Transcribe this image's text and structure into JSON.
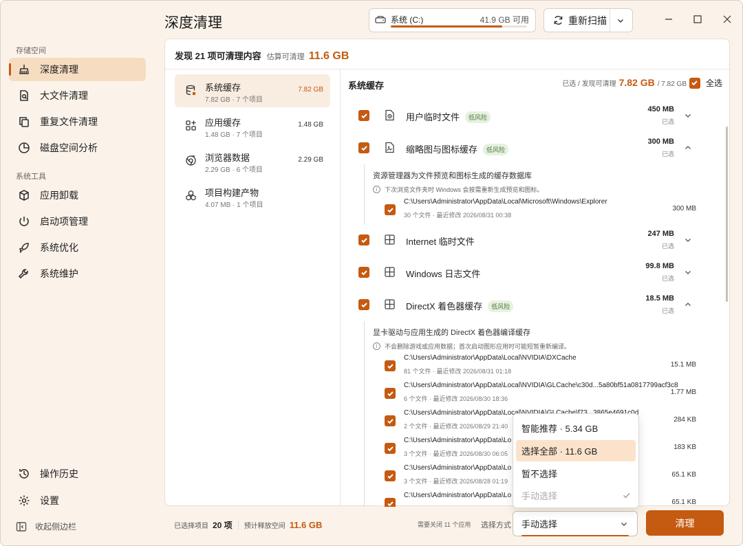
{
  "window": {
    "title": "深度清理"
  },
  "sidebar": {
    "section1": "存储空间",
    "section2": "系统工具",
    "items": [
      {
        "label": "深度清理",
        "icon": "broom-icon"
      },
      {
        "label": "大文件清理",
        "icon": "file-search-icon"
      },
      {
        "label": "重复文件清理",
        "icon": "copy-icon"
      },
      {
        "label": "磁盘空间分析",
        "icon": "pie-chart-icon"
      },
      {
        "label": "应用卸载",
        "icon": "package-remove-icon"
      },
      {
        "label": "启动项管理",
        "icon": "power-icon"
      },
      {
        "label": "系统优化",
        "icon": "rocket-icon"
      },
      {
        "label": "系统维护",
        "icon": "wrench-icon"
      },
      {
        "label": "操作历史",
        "icon": "history-icon"
      },
      {
        "label": "设置",
        "icon": "gear-icon"
      }
    ],
    "collapse": "收起侧边栏"
  },
  "disk": {
    "name": "系统 (C:)",
    "free": "41.9 GB 可用",
    "used_fraction": 0.82
  },
  "toolbar": {
    "rescan": "重新扫描"
  },
  "summary": {
    "prefix": "发现 21 项可清理内容",
    "est_label": "估算可清理",
    "est_value": "11.6 GB"
  },
  "categories": [
    {
      "name": "系统缓存",
      "meta": "7.82 GB · 7 个项目",
      "size": "7.82 GB"
    },
    {
      "name": "应用缓存",
      "meta": "1.48 GB · 7 个项目",
      "size": "1.48 GB"
    },
    {
      "name": "浏览器数据",
      "meta": "2.29 GB · 6 个项目",
      "size": "2.29 GB"
    },
    {
      "name": "项目构建产物",
      "meta": "4.07 MB · 1 个项目",
      "size": ""
    }
  ],
  "right": {
    "title": "系统缓存",
    "stat_label": "已选 / 发现可清理",
    "stat_value": "7.82 GB",
    "stat_total": "/ 7.82 GB",
    "select_all": "全选"
  },
  "items": [
    {
      "name": "用户临时文件",
      "badge": "低风险",
      "size": "450 MB",
      "sub": "已选"
    },
    {
      "name": "缩略图与图标缓存",
      "badge": "低风险",
      "size": "300 MB",
      "sub": "已选"
    },
    {
      "name": "Internet 临时文件",
      "badge": "",
      "size": "247 MB",
      "sub": "已选"
    },
    {
      "name": "Windows 日志文件",
      "badge": "",
      "size": "99.8 MB",
      "sub": "已选"
    },
    {
      "name": "DirectX 着色器缓存",
      "badge": "低风险",
      "size": "18.5 MB",
      "sub": "已选"
    }
  ],
  "detail1": {
    "title": "资源管理器为文件预览和图标生成的缓存数据库",
    "note": "下次浏览文件夹时 Windows 会按需重新生成预览和图标。",
    "paths": [
      {
        "path": "C:\\Users\\Administrator\\AppData\\Local\\Microsoft\\Windows\\Explorer",
        "meta": "30 个文件 · 最近修改 2026/08/31 00:38",
        "size": "300 MB"
      }
    ]
  },
  "detail2": {
    "title": "显卡驱动与应用生成的 DirectX 着色器编译缓存",
    "note": "不会删除游戏或应用数据；首次启动图形应用时可能短暂重新编译。",
    "paths": [
      {
        "path": "C:\\Users\\Administrator\\AppData\\Local\\NVIDIA\\DXCache",
        "meta": "81 个文件 · 最近修改 2026/08/31 01:18",
        "size": "15.1 MB"
      },
      {
        "path": "C:\\Users\\Administrator\\AppData\\Local\\NVIDIA\\GLCache\\c30d...5a80bf51a0817799acf3c8",
        "meta": "6 个文件 · 最近修改 2026/08/30 18:36",
        "size": "1.77 MB"
      },
      {
        "path": "C:\\Users\\Administrator\\AppData\\Local\\NVIDIA\\GLCache\\f73...3865e4691c0d",
        "meta": "2 个文件 · 最近修改 2026/08/29 21:40",
        "size": "284 KB"
      },
      {
        "path": "C:\\Users\\Administrator\\AppData\\Lo",
        "meta": "3 个文件 · 最近修改 2026/08/30 06:05",
        "size": "183 KB"
      },
      {
        "path": "C:\\Users\\Administrator\\AppData\\Lo",
        "meta": "3 个文件 · 最近修改 2026/08/28 01:19",
        "size": "65.1 KB"
      },
      {
        "path": "C:\\Users\\Administrator\\AppData\\Lo",
        "meta": "",
        "size": "65.1 KB"
      }
    ]
  },
  "bottom": {
    "selected_label": "已选择项目",
    "selected_value": "20 项",
    "release_label": "预计释放空间",
    "release_value": "11.6 GB",
    "need_close": "需要关闭 11 个应用",
    "mode_label": "选择方式",
    "mode_value": "手动选择",
    "clean": "清理"
  },
  "dropdown": {
    "options": [
      "智能推荐 · 5.34 GB",
      "选择全部 · 11.6 GB",
      "暂不选择",
      "手动选择"
    ]
  }
}
